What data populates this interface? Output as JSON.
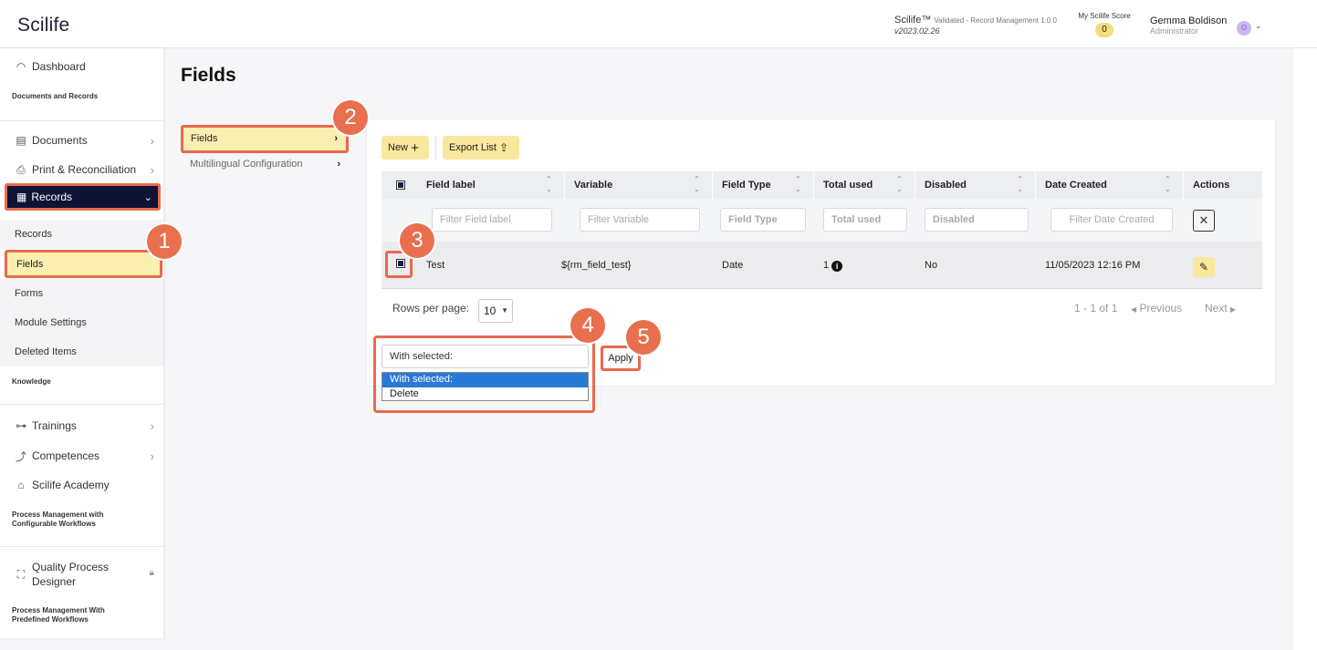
{
  "header": {
    "logo": "Scilife",
    "app_name": "Scilife™",
    "app_validated": "Validated - Record Management 1.0.0",
    "app_version": "v2023.02.26",
    "score_label": "My Scilife Score",
    "score_value": "0",
    "user_name": "Gemma Boldison",
    "user_role": "Administrator"
  },
  "sidebar": {
    "dashboard": "Dashboard",
    "section_docs": "Documents and Records",
    "documents": "Documents",
    "print": "Print & Reconciliation",
    "records": "Records",
    "sub_records": "Records",
    "sub_fields": "Fields",
    "sub_forms": "Forms",
    "sub_module_settings": "Module Settings",
    "sub_deleted": "Deleted Items",
    "section_knowledge": "Knowledge",
    "trainings": "Trainings",
    "competences": "Competences",
    "academy": "Scilife Academy",
    "section_pm_conf_1": "Process Management with",
    "section_pm_conf_2": "Configurable Workflows",
    "qpd_1": "Quality Process",
    "qpd_2": "Designer",
    "section_pm_pre_1": "Process Management With",
    "section_pm_pre_2": "Predefined Workflows"
  },
  "page": {
    "title": "Fields"
  },
  "submenu": {
    "fields": "Fields",
    "multilingual": "Multilingual Configuration"
  },
  "toolbar": {
    "new_label": "New",
    "export_label": "Export List"
  },
  "table": {
    "headers": [
      "Field label",
      "Variable",
      "Field Type",
      "Total used",
      "Disabled",
      "Date Created",
      "Actions"
    ],
    "filters": [
      "Filter Field label",
      "Filter Variable",
      "Field Type",
      "Total used",
      "Disabled",
      "Filter Date Created"
    ],
    "rows": [
      {
        "label": "Test",
        "variable": "${rm_field_test}",
        "type": "Date",
        "total_used": "1",
        "disabled": "No",
        "date_created": "11/05/2023 12:16 PM"
      }
    ]
  },
  "pagination": {
    "rows_per_page_label": "Rows per page:",
    "rows_per_page_value": "10",
    "range": "1 - 1 of 1",
    "previous": "Previous",
    "next": "Next"
  },
  "bulk": {
    "select_value": "With selected:",
    "options": [
      "With selected:",
      "Delete"
    ],
    "apply_label": "Apply"
  },
  "steps": [
    "1",
    "2",
    "3",
    "4",
    "5"
  ],
  "colors": {
    "accent_yellow": "#f9e79c",
    "highlight_orange": "#e86a4e",
    "nav_dark": "#0f1437",
    "dropdown_selected": "#2a79d7"
  }
}
